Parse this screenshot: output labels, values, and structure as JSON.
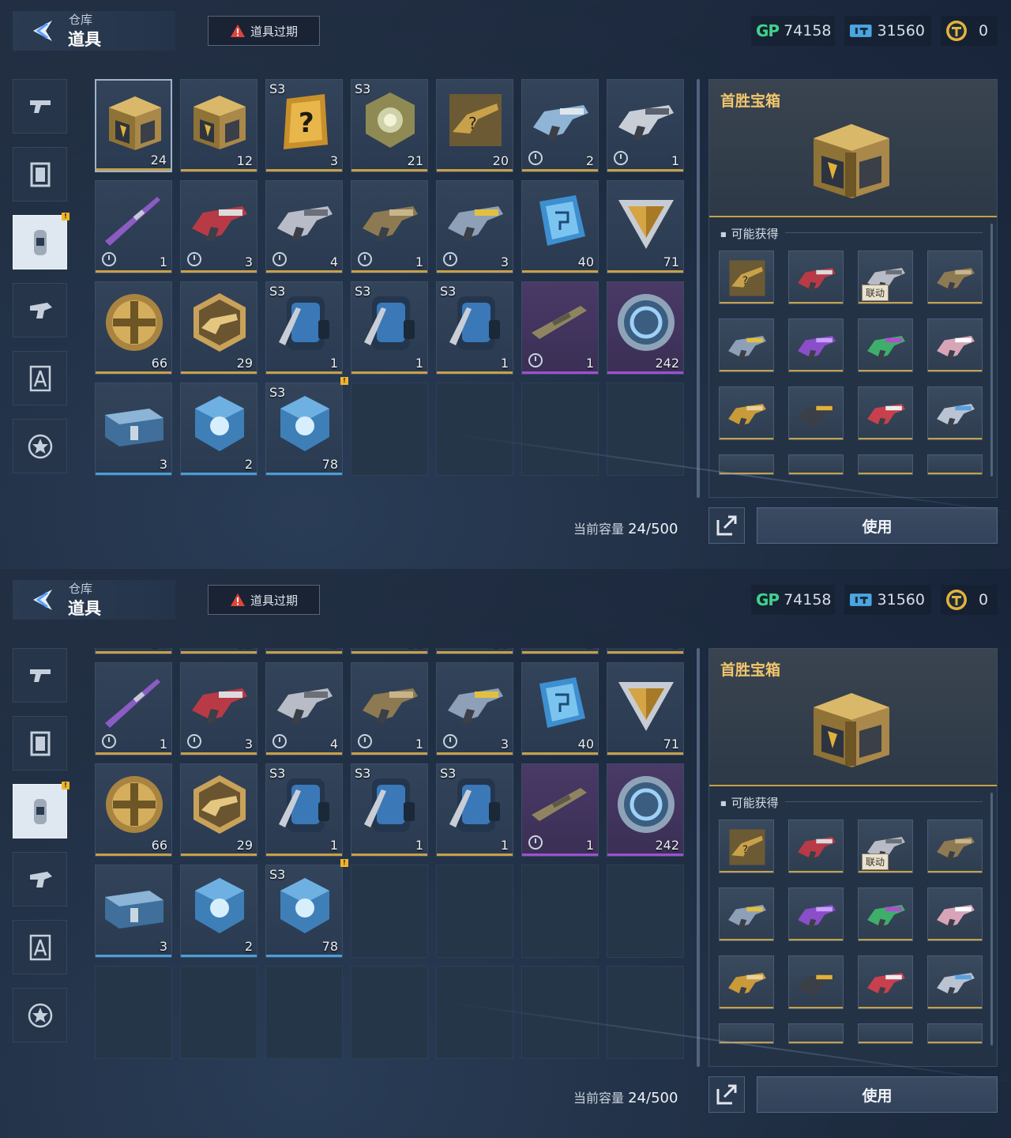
{
  "header": {
    "section": "仓库",
    "title": "道具",
    "expire_button": "道具过期",
    "currencies": [
      {
        "name": "gp-icon",
        "label": "GP",
        "value": "74158"
      },
      {
        "name": "ticket-icon",
        "value": "31560"
      },
      {
        "name": "coin-icon",
        "value": "0"
      }
    ]
  },
  "sidebar": {
    "tabs": [
      {
        "icon": "pistol-icon",
        "active": false
      },
      {
        "icon": "frame-icon",
        "active": false
      },
      {
        "icon": "canister-icon",
        "active": true,
        "badge": "!"
      },
      {
        "icon": "gun-part-icon",
        "active": false
      },
      {
        "icon": "blueprint-icon",
        "active": false
      },
      {
        "icon": "star-badge-icon",
        "active": false
      }
    ]
  },
  "items": [
    {
      "icon": "gold-crate-icon",
      "count": "24",
      "tag": "",
      "rarity": "gold",
      "timed": false
    },
    {
      "icon": "gold-crate-icon",
      "count": "12",
      "tag": "",
      "rarity": "gold",
      "timed": false
    },
    {
      "icon": "mystery-card-icon",
      "count": "3",
      "tag": "S3",
      "rarity": "gold",
      "timed": false
    },
    {
      "icon": "gold-orb-crate-icon",
      "count": "21",
      "tag": "S3",
      "rarity": "gold",
      "timed": false
    },
    {
      "icon": "gun-blueprint-icon",
      "count": "20",
      "tag": "",
      "rarity": "gold",
      "timed": false
    },
    {
      "icon": "pistol-skin-icon",
      "count": "2",
      "tag": "",
      "rarity": "gold",
      "timed": true
    },
    {
      "icon": "smg-skin-icon",
      "count": "1",
      "tag": "",
      "rarity": "gold",
      "timed": true
    },
    {
      "icon": "sniper-skin-icon",
      "count": "1",
      "tag": "",
      "rarity": "gold",
      "timed": true
    },
    {
      "icon": "red-gun-skin-icon",
      "count": "3",
      "tag": "",
      "rarity": "gold",
      "timed": true
    },
    {
      "icon": "silver-gun-skin-icon",
      "count": "4",
      "tag": "",
      "rarity": "gold",
      "timed": true
    },
    {
      "icon": "gold-pistol-skin-icon",
      "count": "1",
      "tag": "",
      "rarity": "gold",
      "timed": true
    },
    {
      "icon": "blue-gun-skin-icon",
      "count": "3",
      "tag": "",
      "rarity": "gold",
      "timed": true
    },
    {
      "icon": "chip-card-icon",
      "count": "40",
      "tag": "",
      "rarity": "gold",
      "timed": false
    },
    {
      "icon": "triangle-shard-icon",
      "count": "71",
      "tag": "",
      "rarity": "gold",
      "timed": false
    },
    {
      "icon": "gold-medal-icon",
      "count": "66",
      "tag": "",
      "rarity": "gold",
      "timed": false
    },
    {
      "icon": "hex-gun-badge-icon",
      "count": "29",
      "tag": "",
      "rarity": "gold",
      "timed": false
    },
    {
      "icon": "backpack-icon",
      "count": "1",
      "tag": "S3",
      "rarity": "gold",
      "timed": false
    },
    {
      "icon": "backpack-icon",
      "count": "1",
      "tag": "S3",
      "rarity": "gold",
      "timed": false
    },
    {
      "icon": "backpack-icon",
      "count": "1",
      "tag": "S3",
      "rarity": "gold",
      "timed": false
    },
    {
      "icon": "rifle-skin-icon",
      "count": "1",
      "tag": "",
      "rarity": "purple",
      "timed": true
    },
    {
      "icon": "blue-token-icon",
      "count": "242",
      "tag": "",
      "rarity": "purple",
      "timed": false
    },
    {
      "icon": "blue-case-icon",
      "count": "3",
      "tag": "",
      "rarity": "blue",
      "timed": false
    },
    {
      "icon": "blue-orb-crate-icon",
      "count": "2",
      "tag": "",
      "rarity": "blue",
      "timed": false
    },
    {
      "icon": "blue-orb-crate-icon",
      "count": "78",
      "tag": "S3",
      "rarity": "blue",
      "timed": false,
      "new": true
    }
  ],
  "detail": {
    "title": "首胜宝箱",
    "art": "gold-crate-icon",
    "obtainable_label": "可能获得",
    "linked_tag": "联动",
    "rewards": [
      "gun-blueprint-icon",
      "red-gun-skin-icon",
      "silver-gun-skin-icon",
      "gold-pistol-skin-icon",
      "blue-gun-skin-icon",
      "purple-gun-skin-icon",
      "green-gun-skin-icon",
      "pink-gun-skin-icon",
      "gold-smg-skin-icon",
      "gold-rifle-skin-icon",
      "crimson-gun-skin-icon",
      "silver-pistol-skin-icon"
    ]
  },
  "footer": {
    "capacity_label": "当前容量",
    "capacity_value": "24",
    "capacity_max": "/500",
    "use_button": "使用"
  },
  "colors": {
    "gold": "#c8a048",
    "purple": "#a04fd0",
    "blue": "#4a9ed8",
    "accent_title": "#f2c66d",
    "gp": "#3fd28a"
  }
}
